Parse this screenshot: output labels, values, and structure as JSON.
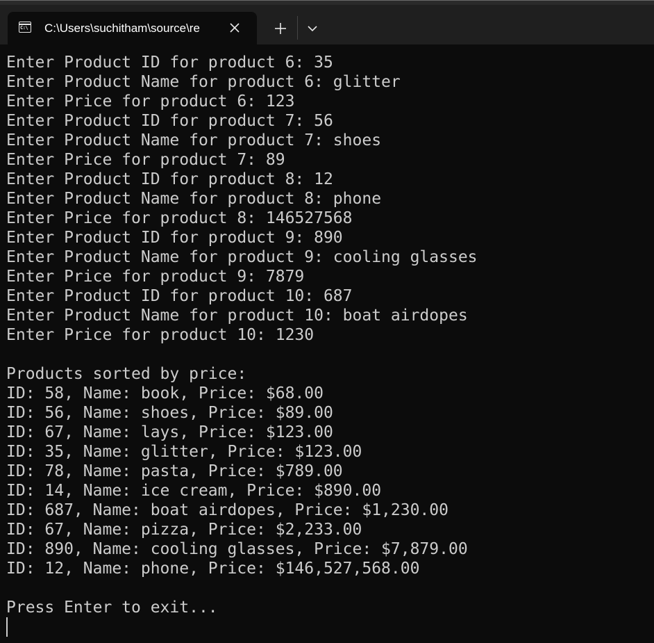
{
  "window": {
    "tab_title": "C:\\Users\\suchitham\\source\\re",
    "tab_icon": "console-icon",
    "close_icon": "close-icon",
    "new_tab_icon": "plus-icon",
    "dropdown_icon": "chevron-down-icon"
  },
  "console": {
    "lines": [
      "Enter Product ID for product 6: 35",
      "Enter Product Name for product 6: glitter",
      "Enter Price for product 6: 123",
      "Enter Product ID for product 7: 56",
      "Enter Product Name for product 7: shoes",
      "Enter Price for product 7: 89",
      "Enter Product ID for product 8: 12",
      "Enter Product Name for product 8: phone",
      "Enter Price for product 8: 146527568",
      "Enter Product ID for product 9: 890",
      "Enter Product Name for product 9: cooling glasses",
      "Enter Price for product 9: 7879",
      "Enter Product ID for product 10: 687",
      "Enter Product Name for product 10: boat airdopes",
      "Enter Price for product 10: 1230",
      "",
      "Products sorted by price:",
      "ID: 58, Name: book, Price: $68.00",
      "ID: 56, Name: shoes, Price: $89.00",
      "ID: 67, Name: lays, Price: $123.00",
      "ID: 35, Name: glitter, Price: $123.00",
      "ID: 78, Name: pasta, Price: $789.00",
      "ID: 14, Name: ice cream, Price: $890.00",
      "ID: 687, Name: boat airdopes, Price: $1,230.00",
      "ID: 67, Name: pizza, Price: $2,233.00",
      "ID: 890, Name: cooling glasses, Price: $7,879.00",
      "ID: 12, Name: phone, Price: $146,527,568.00",
      "",
      "Press Enter to exit..."
    ]
  },
  "colors": {
    "background": "#0c0c0c",
    "titlebar": "#1f1f1f",
    "text": "#cccccc"
  }
}
